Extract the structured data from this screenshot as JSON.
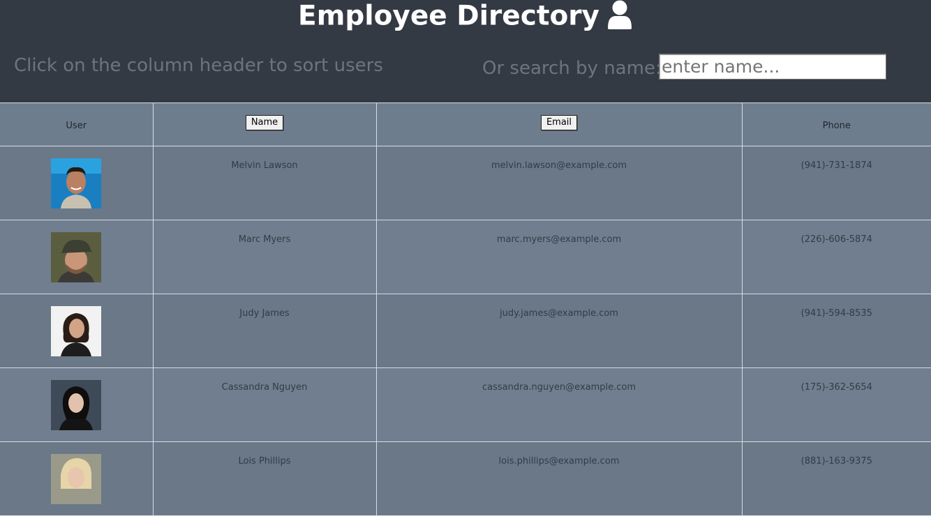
{
  "header": {
    "title": "Employee Directory",
    "title_icon": "user-icon",
    "sort_hint": "Click on the column header to sort users",
    "search_label": "Or search by name:",
    "search_placeholder": "enter name..."
  },
  "table": {
    "columns": {
      "user": "User",
      "name": "Name",
      "email": "Email",
      "phone": "Phone"
    },
    "rows": [
      {
        "name": "Melvin Lawson",
        "email": "melvin.lawson@example.com",
        "phone": "(941)-731-1874",
        "avatar": "avatar-photo"
      },
      {
        "name": "Marc Myers",
        "email": "marc.myers@example.com",
        "phone": "(226)-606-5874",
        "avatar": "avatar-photo"
      },
      {
        "name": "Judy James",
        "email": "judy.james@example.com",
        "phone": "(941)-594-8535",
        "avatar": "avatar-photo"
      },
      {
        "name": "Cassandra Nguyen",
        "email": "cassandra.nguyen@example.com",
        "phone": "(175)-362-5654",
        "avatar": "avatar-photo"
      },
      {
        "name": "Lois Phillips",
        "email": "lois.phillips@example.com",
        "phone": "(881)-163-9375",
        "avatar": "avatar-photo"
      }
    ]
  },
  "colors": {
    "header_bg": "#343a43",
    "table_bg": "#6e7b8c",
    "hint_text": "#6c757d"
  }
}
